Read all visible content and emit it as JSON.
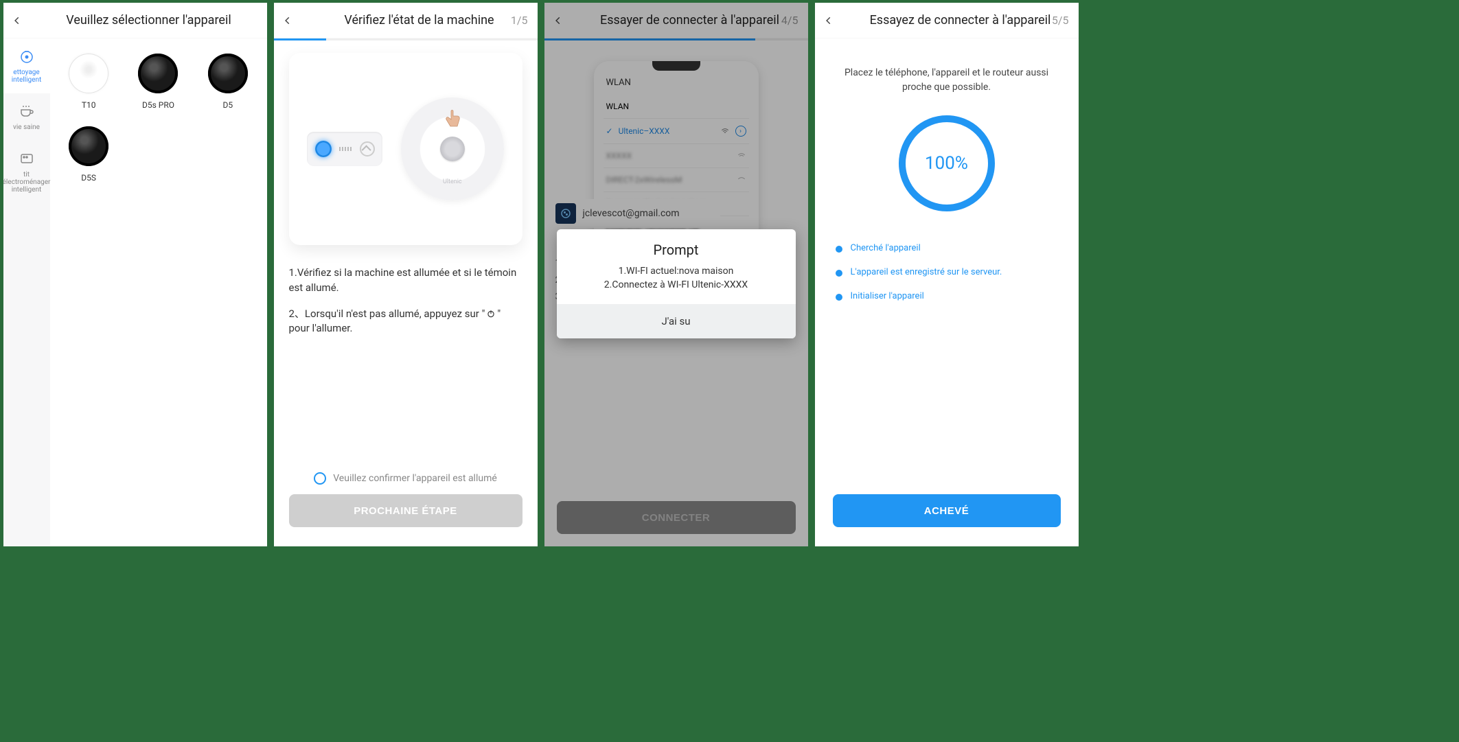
{
  "screen1": {
    "title": "Veuillez sélectionner l'appareil",
    "categories": [
      {
        "label": "ettoyage intelligent",
        "active": true
      },
      {
        "label": "vie saine",
        "active": false
      },
      {
        "label": "tit électroménager intelligent",
        "active": false
      }
    ],
    "devices": [
      {
        "name": "T10",
        "tone": "light"
      },
      {
        "name": "D5s PRO",
        "tone": "dark"
      },
      {
        "name": "D5",
        "tone": "dark"
      },
      {
        "name": "D5S",
        "tone": "dark"
      }
    ]
  },
  "screen2": {
    "title": "Vérifiez l'état de la machine",
    "step": "1/5",
    "progress_pct": 20,
    "robot_brand": "Ultenic",
    "line1": "1.Vérifiez si la machine est allumée et si le témoin est allumé.",
    "line2a": "2、Lorsqu'il n'est pas allumé, appuyez sur \"",
    "line2b": "\" pour l'allumer.",
    "confirm": "Veuillez confirmer l'appareil est allumé",
    "button": "PROCHAINE ÉTAPE"
  },
  "screen3": {
    "title": "Essayer de connecter à l'appareil",
    "step": "4/5",
    "progress_pct": 80,
    "wlan_label": "WLAN",
    "selected_network": "Ultenic–XXXX",
    "email": "jclevescot@gmail.com",
    "hidden_steps": [
      "1.",
      "2.",
      "3."
    ],
    "prompt_title": "Prompt",
    "prompt_line1": "1.WI-FI actuel:nova maison",
    "prompt_line2": "2.Connectez à WI-FI Ultenic-XXXX",
    "prompt_ok": "J'ai su",
    "button": "CONNECTER"
  },
  "screen4": {
    "title": "Essayez de connecter à l'appareil",
    "step": "5/5",
    "progress_pct": 100,
    "hint": "Placez le téléphone, l'appareil et le routeur aussi proche que possible.",
    "percent": "100%",
    "steps": [
      "Cherché l'appareil",
      "L'appareil est enregistré sur le serveur.",
      "Initialiser l'appareil"
    ],
    "button": "ACHEVÉ"
  }
}
